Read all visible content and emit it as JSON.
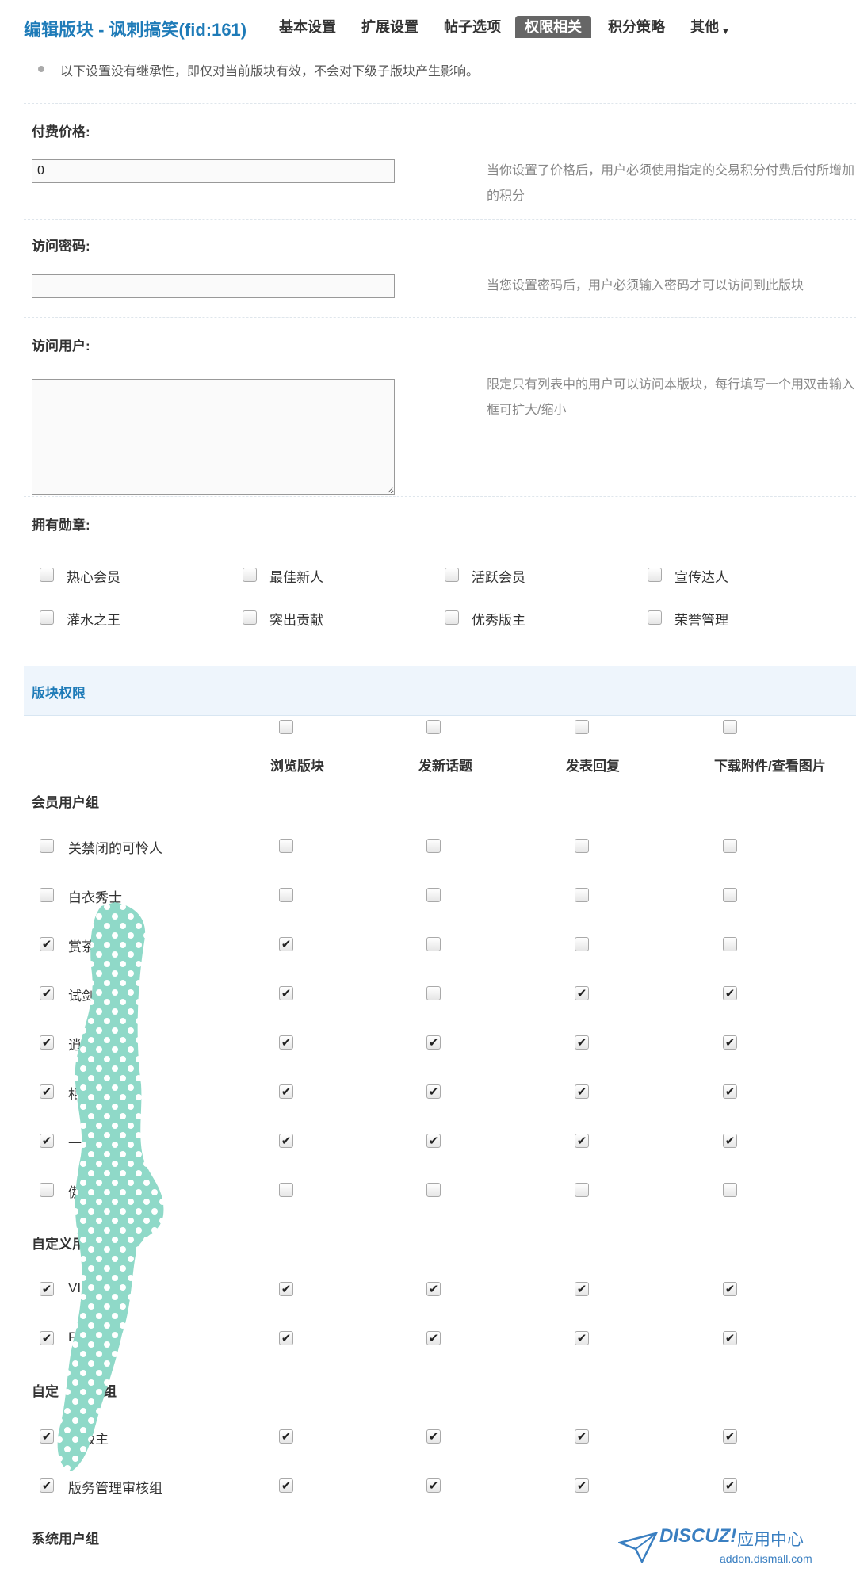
{
  "header": {
    "title": "编辑版块 - 讽刺搞笑(fid:161)",
    "tabs": [
      {
        "label": "基本设置"
      },
      {
        "label": "扩展设置"
      },
      {
        "label": "帖子选项"
      },
      {
        "label": "权限相关",
        "active": true
      },
      {
        "label": "积分策略"
      },
      {
        "label": "其他"
      }
    ]
  },
  "notice": "以下设置没有继承性，即仅对当前版块有效，不会对下级子版块产生影响。",
  "settings": {
    "price": {
      "label": "付费价格:",
      "value": "0",
      "tip": "当你设置了价格后，用户必须使用指定的交易积分付费后付所增加的积分"
    },
    "password": {
      "label": "访问密码:",
      "value": "",
      "tip": "当您设置密码后，用户必须输入密码才可以访问到此版块"
    },
    "users": {
      "label": "访问用户:",
      "value": "",
      "tip": "限定只有列表中的用户可以访问本版块，每行填写一个用双击输入框可扩大/缩小"
    }
  },
  "medals": {
    "label": "拥有勋章:",
    "items": [
      {
        "label": "热心会员",
        "checked": false
      },
      {
        "label": "最佳新人",
        "checked": false
      },
      {
        "label": "活跃会员",
        "checked": false
      },
      {
        "label": "宣传达人",
        "checked": false
      },
      {
        "label": "灌水之王",
        "checked": false
      },
      {
        "label": "突出贡献",
        "checked": false
      },
      {
        "label": "优秀版主",
        "checked": false
      },
      {
        "label": "荣誉管理",
        "checked": false
      }
    ]
  },
  "perm": {
    "section_title": "版块权限",
    "columns": [
      "浏览版块",
      "发新话题",
      "发表回复",
      "下载附件/查看图片"
    ],
    "groups": [
      {
        "title": "会员用户组",
        "rows": [
          {
            "name": "关禁闭的可怜人",
            "all": false,
            "perms": [
              false,
              false,
              false,
              false
            ]
          },
          {
            "name": "白衣秀士",
            "all": false,
            "perms": [
              false,
              false,
              false,
              false
            ]
          },
          {
            "name": "赏茶闲",
            "all": true,
            "perms": [
              true,
              false,
              false,
              false
            ]
          },
          {
            "name": "试剑江",
            "all": true,
            "perms": [
              true,
              false,
              true,
              true
            ]
          },
          {
            "name": "逍遥游",
            "all": true,
            "perms": [
              true,
              true,
              true,
              true
            ]
          },
          {
            "name": "相",
            "all": true,
            "perms": [
              true,
              true,
              true,
              true
            ]
          },
          {
            "name": "一代",
            "all": true,
            "perms": [
              true,
              true,
              true,
              true
            ]
          },
          {
            "name": "傲世",
            "all": false,
            "perms": [
              false,
              false,
              false,
              false
            ]
          }
        ]
      },
      {
        "title": "自定义用",
        "rows": [
          {
            "name": "VI",
            "all": true,
            "perms": [
              true,
              true,
              true,
              true
            ]
          },
          {
            "name": "P",
            "all": true,
            "perms": [
              true,
              true,
              true,
              true
            ]
          }
        ]
      },
      {
        "title": "自定",
        "title_tail": "组",
        "rows": [
          {
            "name": "习版主",
            "all": true,
            "perms": [
              true,
              true,
              true,
              true
            ]
          },
          {
            "name": "版务管理审核组",
            "all": true,
            "perms": [
              true,
              true,
              true,
              true
            ]
          }
        ]
      },
      {
        "title": "系统用户组",
        "rows": []
      }
    ]
  },
  "watermark": {
    "brand": "DISCUZ!",
    "sub": "应用中心",
    "url": "addon.dismall.com"
  },
  "colors": {
    "accent": "#1e7bb8",
    "active_tab": "#666666",
    "band_bg": "#eef5fc",
    "blob": "#8fd9c8"
  }
}
